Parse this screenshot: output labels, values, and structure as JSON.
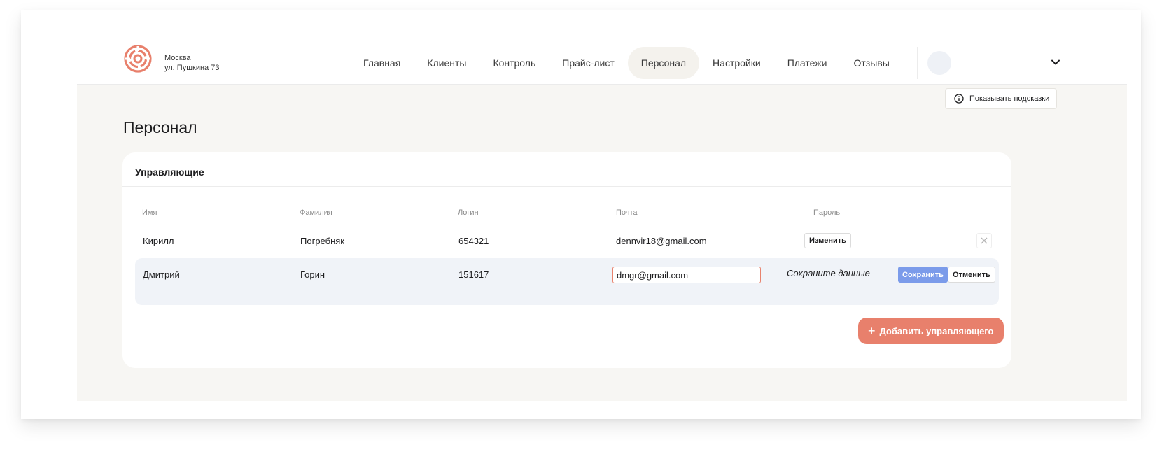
{
  "header": {
    "location_city": "Москва",
    "location_address": "ул. Пушкина 73",
    "nav": [
      "Главная",
      "Клиенты",
      "Контроль",
      "Прайс-лист",
      "Персонал",
      "Настройки",
      "Платежи",
      "Отзывы"
    ],
    "active_nav": "Персонал"
  },
  "hints_button": "Показывать подсказки",
  "page_title": "Персонал",
  "card": {
    "title": "Управляющие",
    "columns": [
      "Имя",
      "Фамилия",
      "Логин",
      "Почта",
      "Пароль"
    ],
    "rows": [
      {
        "first_name": "Кирилл",
        "last_name": "Погребняк",
        "login": "654321",
        "email": "dennvir18@gmail.com",
        "password_action": "Изменить"
      },
      {
        "first_name": "Дмитрий",
        "last_name": "Горин",
        "login": "151617",
        "email_input_value": "dmgr@gmail.com",
        "hint": "Сохраните данные",
        "save_label": "Сохранить",
        "cancel_label": "Отменить"
      }
    ],
    "add_button": "Добавить управляющего"
  },
  "colors": {
    "accent": "#e8806c",
    "primary_button": "#7b9bea",
    "edit_row_bg": "#f0f3f8",
    "page_bg": "#f7f6f3"
  },
  "icons": [
    "logo-icon",
    "chevron-down-icon",
    "info-icon",
    "close-icon",
    "plus-icon"
  ]
}
